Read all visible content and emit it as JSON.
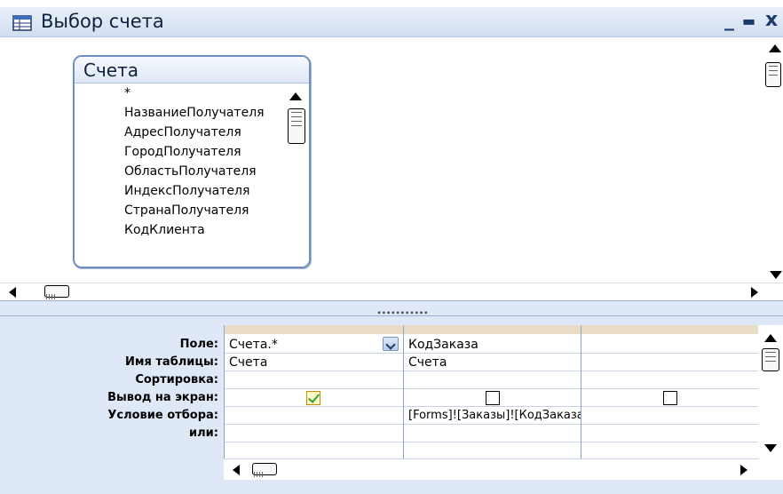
{
  "window": {
    "title": "Выбор счета",
    "icon": "query-icon",
    "controls": {
      "minimize": "_",
      "maximize": "▬",
      "close": "x"
    }
  },
  "field_list": {
    "table_name": "Счета",
    "fields": [
      "*",
      "НазваниеПолучателя",
      "АдресПолучателя",
      "ГородПолучателя",
      "ОбластьПолучателя",
      "ИндексПолучателя",
      "СтранаПолучателя",
      "КодКлиента"
    ]
  },
  "grid": {
    "row_labels": [
      "Поле:",
      "Имя таблицы:",
      "Сортировка:",
      "Вывод на экран:",
      "Условие отбора:",
      "или:"
    ],
    "columns": [
      {
        "field": "Счета.*",
        "table": "Счета",
        "sort": "",
        "show": true,
        "criteria": "",
        "or": ""
      },
      {
        "field": "КодЗаказа",
        "table": "Счета",
        "sort": "",
        "show": false,
        "criteria": "[Forms]![Заказы]![КодЗаказа]",
        "or": ""
      },
      {
        "field": "",
        "table": "",
        "sort": "",
        "show": false,
        "criteria": "",
        "or": ""
      }
    ]
  },
  "colors": {
    "pane_background": "#dfe8f6",
    "border": "#8ea5c8",
    "checkmark": "#2aa52a"
  }
}
